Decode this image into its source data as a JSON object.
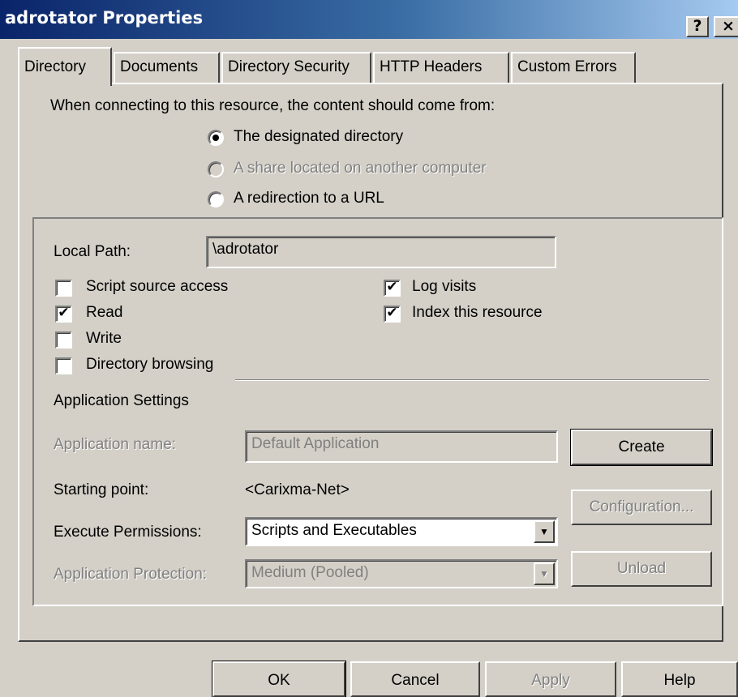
{
  "window": {
    "title": "adrotator Properties",
    "help_btn": "?",
    "close_btn": "×"
  },
  "tabs": [
    {
      "label": "Directory",
      "active": true
    },
    {
      "label": "Documents"
    },
    {
      "label": "Directory Security"
    },
    {
      "label": "HTTP Headers"
    },
    {
      "label": "Custom Errors"
    }
  ],
  "content_source": {
    "prompt": "When connecting to this resource, the content should come from:",
    "options": [
      {
        "label": "The designated directory",
        "selected": true,
        "enabled": true
      },
      {
        "label": "A share located on another computer",
        "selected": false,
        "enabled": false
      },
      {
        "label": "A redirection to a URL",
        "selected": false,
        "enabled": true
      }
    ]
  },
  "local_path": {
    "label": "Local Path:",
    "value": "\\adrotator"
  },
  "permissions": {
    "script_source_access": {
      "label": "Script source access",
      "checked": false
    },
    "read": {
      "label": "Read",
      "checked": true
    },
    "write": {
      "label": "Write",
      "checked": false
    },
    "directory_browsing": {
      "label": "Directory browsing",
      "checked": false
    },
    "log_visits": {
      "label": "Log visits",
      "checked": true
    },
    "index_resource": {
      "label": "Index this resource",
      "checked": true
    }
  },
  "app_settings": {
    "heading": "Application Settings",
    "app_name_label": "Application name:",
    "app_name_value": "Default Application",
    "starting_point_label": "Starting point:",
    "starting_point_value": "<Carixma-Net>",
    "exec_perm_label": "Execute Permissions:",
    "exec_perm_value": "Scripts and Executables",
    "app_protection_label": "Application Protection:",
    "app_protection_value": "Medium (Pooled)",
    "create_btn": "Create",
    "config_btn": "Configuration...",
    "unload_btn": "Unload"
  },
  "footer": {
    "ok": "OK",
    "cancel": "Cancel",
    "apply": "Apply",
    "help": "Help"
  },
  "checkmark": "✔",
  "dropdown_arrow": "▼"
}
